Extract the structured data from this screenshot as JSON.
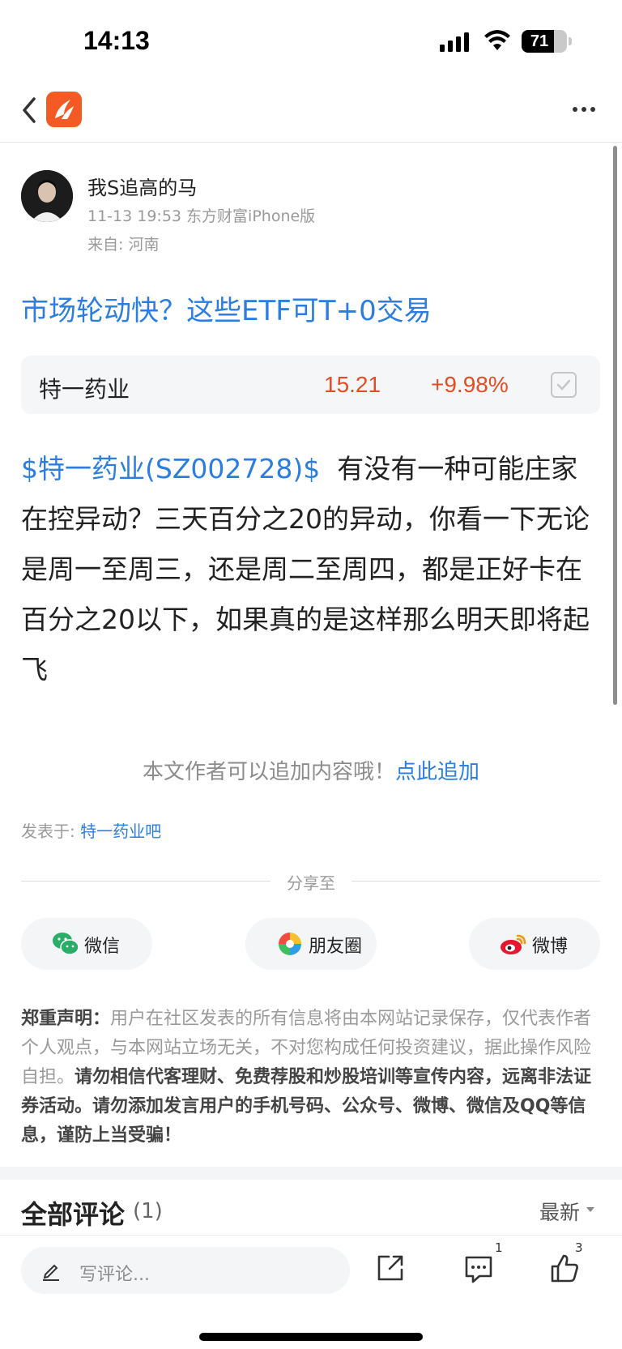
{
  "status_bar": {
    "time": "14:13",
    "battery": "71",
    "battery_level": 0.71
  },
  "nav": {
    "back_icon": "chevron-left-icon",
    "logo_icon": "eastmoney-logo-icon",
    "more_icon": "more-horizontal-icon"
  },
  "author": {
    "name": "我S追高的马",
    "meta": "11-13 19:53 东方财富iPhone版",
    "location": "来自: 河南"
  },
  "post": {
    "title": "市场轮动快？这些ETF可T+0交易",
    "stock_link": "$特一药业(SZ002728)$",
    "body": "有没有一种可能庄家在控异动？三天百分之20的异动，你看一下无论是周一至周三，还是周二至周四，都是正好卡在百分之20以下，如果真的是这样那么明天即将起飞"
  },
  "stock_card": {
    "name": "特一药业",
    "price": "15.21",
    "change": "+9.98%",
    "color": "#e34d23"
  },
  "append": {
    "text": "本文作者可以追加内容哦！",
    "link": "点此追加"
  },
  "posted_in": {
    "label": "发表于: ",
    "bar": "特一药业吧"
  },
  "share": {
    "label": "分享至",
    "buttons": [
      {
        "label": "微信",
        "icon": "wechat-icon"
      },
      {
        "label": "朋友圈",
        "icon": "moments-icon"
      },
      {
        "label": "微博",
        "icon": "weibo-icon"
      }
    ]
  },
  "disclaimer": {
    "heading": "郑重声明：",
    "text1": "用户在社区发表的所有信息将由本网站记录保存，仅代表作者个人观点，与本网站立场无关，不对您构成任何投资建议，据此操作风险自担。",
    "text2": "请勿相信代客理财、免费荐股和炒股培训等宣传内容，远离非法证券活动。请勿添加发言用户的手机号码、公众号、微博、微信及QQ等信息，谨防上当受骗！"
  },
  "comments": {
    "title": "全部评论",
    "count": "(1)",
    "sort": "最新"
  },
  "bottom_bar": {
    "placeholder": "写评论...",
    "message_count": "1",
    "like_count": "3"
  },
  "colors": {
    "link": "#2b7de0",
    "up": "#e34d23",
    "brand": "#f45a23"
  }
}
